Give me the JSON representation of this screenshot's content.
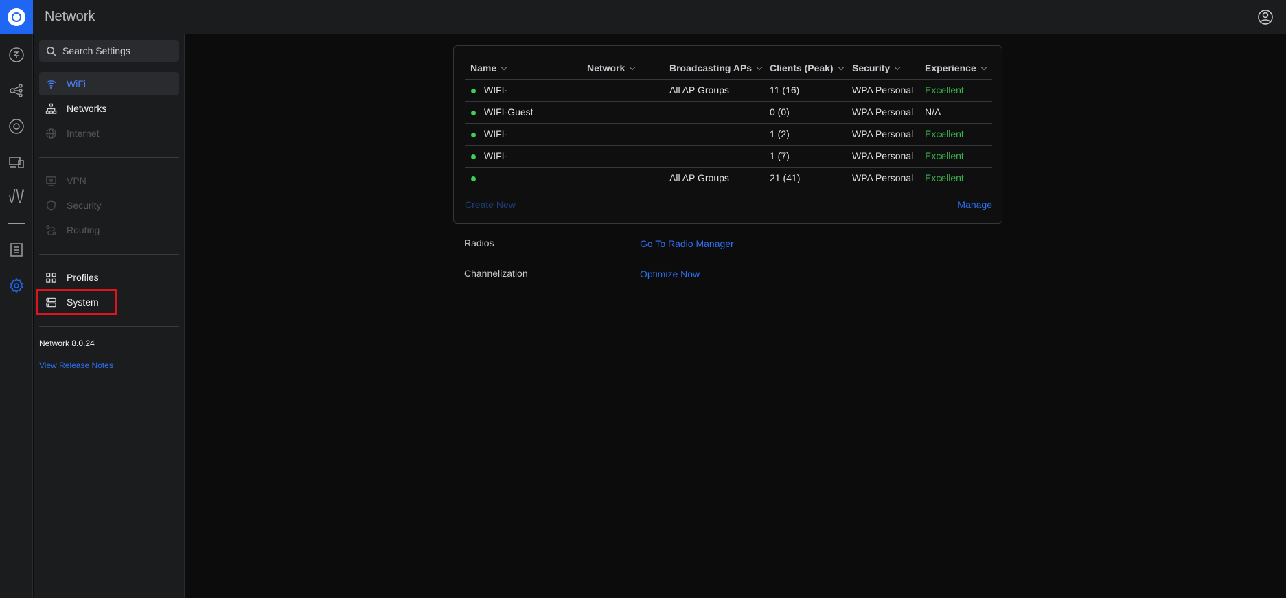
{
  "app": {
    "title": "Network"
  },
  "rail": {
    "icons": [
      "dashboard-icon",
      "topology-icon",
      "devices-icon",
      "clients-icon",
      "insights-icon",
      "logs-icon",
      "settings-icon"
    ]
  },
  "sidebar": {
    "search_placeholder": "Search Settings",
    "items": [
      {
        "label": "WiFi",
        "state": "active"
      },
      {
        "label": "Networks",
        "state": "normal"
      },
      {
        "label": "Internet",
        "state": "disabled"
      },
      {
        "label": "VPN",
        "state": "disabled"
      },
      {
        "label": "Security",
        "state": "disabled"
      },
      {
        "label": "Routing",
        "state": "disabled"
      },
      {
        "label": "Profiles",
        "state": "normal"
      },
      {
        "label": "System",
        "state": "normal"
      }
    ],
    "version": "Network 8.0.24",
    "release_notes": "View Release Notes"
  },
  "wifi_table": {
    "columns": [
      "Name",
      "Network",
      "Broadcasting APs",
      "Clients (Peak)",
      "Security",
      "Experience"
    ],
    "rows": [
      {
        "name": "WIFI·",
        "network": "",
        "aps": "All AP Groups",
        "clients": "11 (16)",
        "security": "WPA Personal",
        "experience": "Excellent"
      },
      {
        "name": "WIFI-Guest",
        "network": "",
        "aps": "",
        "clients": "0 (0)",
        "security": "WPA Personal",
        "experience": "N/A"
      },
      {
        "name": "WIFI-",
        "network": "",
        "aps": "",
        "clients": "1 (2)",
        "security": "WPA Personal",
        "experience": "Excellent"
      },
      {
        "name": "WIFI-",
        "network": "",
        "aps": "",
        "clients": "1 (7)",
        "security": "WPA Personal",
        "experience": "Excellent"
      },
      {
        "name": "",
        "network": "",
        "aps": "All AP Groups",
        "clients": "21 (41)",
        "security": "WPA Personal",
        "experience": "Excellent"
      }
    ],
    "status_color": "#3ad05a",
    "create_new": "Create New",
    "manage": "Manage"
  },
  "radios": {
    "label": "Radios",
    "link": "Go To Radio Manager"
  },
  "channelization": {
    "label": "Channelization",
    "link": "Optimize Now"
  },
  "colors": {
    "accent": "#1f66f2",
    "link": "#2e6ff0",
    "excellent": "#3ab34f",
    "highlight": "#e0141e"
  }
}
